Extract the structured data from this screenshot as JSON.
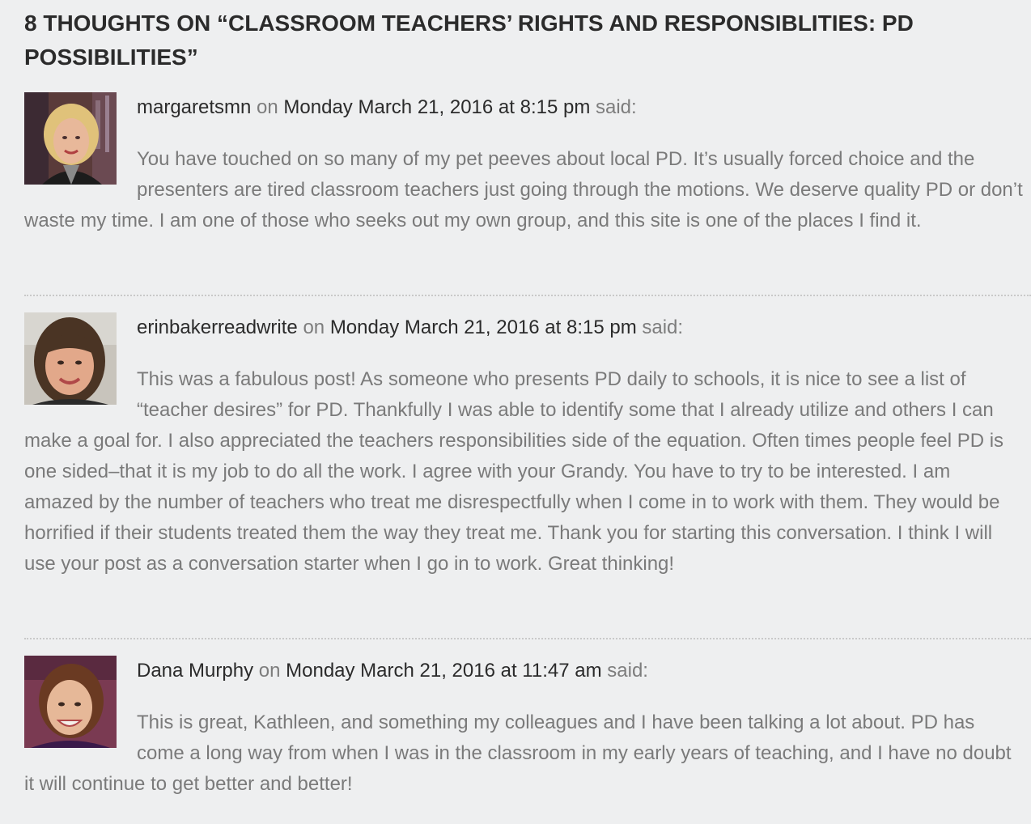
{
  "heading": "8 THOUGHTS ON “CLASSROOM TEACHERS’ RIGHTS AND RESPONSIBLITIES: PD POSSIBILITIES”",
  "on_word": "on",
  "said_word": "said:",
  "comments": [
    {
      "author": "margaretsmn",
      "date": "Monday March 21, 2016 at 8:15 pm",
      "text": "You have touched on so many of my pet peeves about local PD. It’s usually forced choice and the presenters are tired classroom teachers just going through the motions. We deserve quality PD or don’t waste my time. I am one of those who seeks out my own group, and this site is one of the places I find it."
    },
    {
      "author": "erinbakerreadwrite",
      "date": "Monday March 21, 2016 at 8:15 pm",
      "text": "This was a fabulous post! As someone who presents PD daily to schools, it is nice to see a list of “teacher desires” for PD. Thankfully I was able to identify some that I already utilize and others I can make a goal for. I also appreciated the teachers responsibilities side of the equation. Often times people feel PD is one sided–that it is my job to do all the work. I agree with your Grandy. You have to try to be interested. I am amazed by the number of teachers who treat me disrespectfully when I come in to work with them. They would be horrified if their students treated them the way they treat me. Thank you for starting this conversation. I think I will use your post as a conversation starter when I go in to work. Great thinking!"
    },
    {
      "author": "Dana Murphy",
      "date": "Monday March 21, 2016 at 11:47 am",
      "text": "This is great, Kathleen, and something my colleagues and I have been talking a lot about. PD has come a long way from when I was in the classroom in my early years of teaching, and I have no doubt it will continue to get better and better!"
    }
  ],
  "colors": {
    "background": "#eeeff0",
    "heading": "#2b2b2b",
    "author": "#2b2b2b",
    "body_text": "#7a7a7a",
    "divider": "#c9c9c9"
  }
}
